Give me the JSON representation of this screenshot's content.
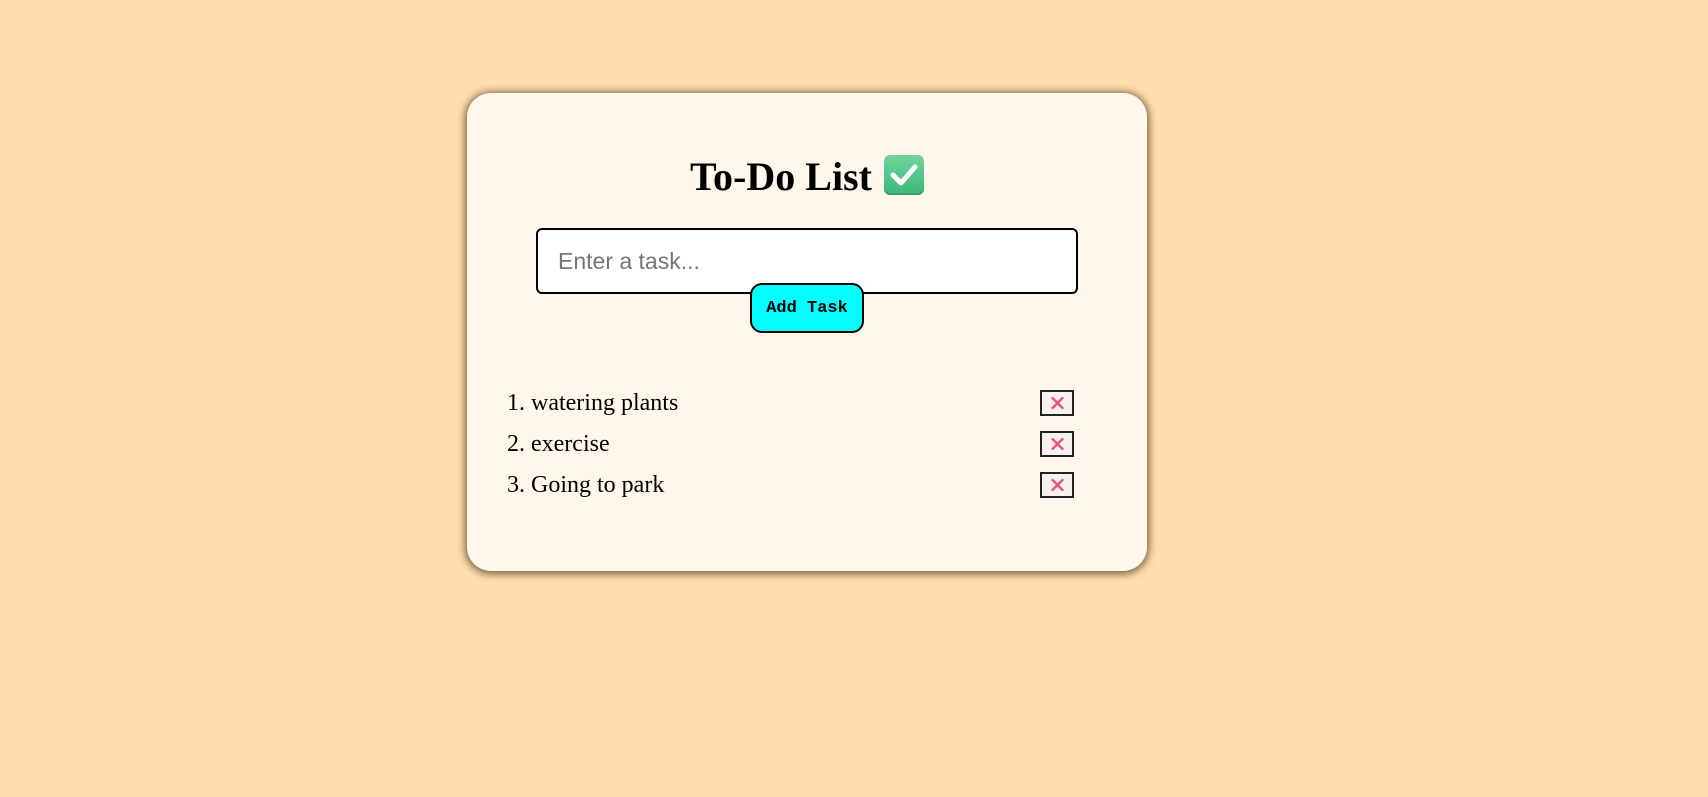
{
  "app": {
    "title": "To-Do List",
    "title_icon": "white-heavy-check-mark-icon"
  },
  "input": {
    "placeholder": "Enter a task...",
    "value": ""
  },
  "add_button": {
    "label": "Add Task"
  },
  "tasks": [
    {
      "number": "1.",
      "text": "watering plants",
      "delete_icon": "close-icon"
    },
    {
      "number": "2.",
      "text": "exercise",
      "delete_icon": "close-icon"
    },
    {
      "number": "3.",
      "text": "Going to park",
      "delete_icon": "close-icon"
    }
  ],
  "colors": {
    "page_background": "#ffdead",
    "card_background": "#fff7ec",
    "button_background": "#00ffff",
    "delete_x": "#e8567e",
    "check_icon": "#4cc487"
  }
}
